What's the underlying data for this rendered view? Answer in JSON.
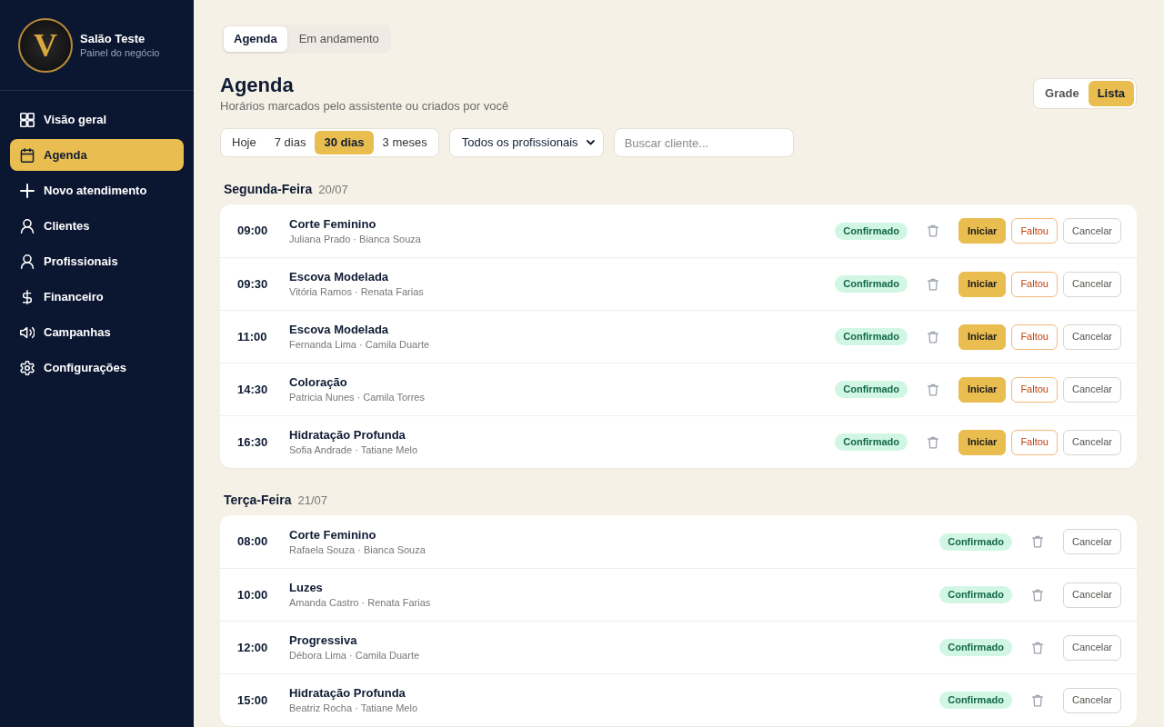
{
  "sidebar": {
    "brand": {
      "logo_letter": "V",
      "name": "Salão Teste",
      "subtitle": "Painel do negócio"
    },
    "items": [
      {
        "label": "Visão geral",
        "selected": false
      },
      {
        "label": "Agenda",
        "selected": true
      },
      {
        "label": "Novo atendimento",
        "selected": false
      },
      {
        "label": "Clientes",
        "selected": false
      },
      {
        "label": "Profissionais",
        "selected": false
      },
      {
        "label": "Financeiro",
        "selected": false
      },
      {
        "label": "Campanhas",
        "selected": false
      },
      {
        "label": "Configurações",
        "selected": false
      }
    ]
  },
  "tabs": [
    {
      "label": "Agenda",
      "selected": true
    },
    {
      "label": "Em andamento",
      "selected": false
    }
  ],
  "header": {
    "title": "Agenda",
    "subtitle": "Horários marcados pelo assistente ou criados por você"
  },
  "view_toggle": [
    {
      "label": "Grade",
      "selected": false
    },
    {
      "label": "Lista",
      "selected": true
    }
  ],
  "filters": {
    "periods": [
      {
        "label": "Hoje",
        "selected": false
      },
      {
        "label": "7 dias",
        "selected": false
      },
      {
        "label": "30 dias",
        "selected": true
      },
      {
        "label": "3 meses",
        "selected": false
      }
    ],
    "professional": {
      "value": "Todos os profissionais"
    },
    "search": {
      "placeholder": "Buscar cliente..."
    }
  },
  "days": [
    {
      "weekday": "Segunda-Feira",
      "date": "20/07",
      "appointments": [
        {
          "time": "09:00",
          "service": "Corte Feminino",
          "people": "Juliana Prado · Bianca Souza",
          "status": "Confirmado",
          "actions": [
            {
              "label": "Iniciar",
              "kind": "primary"
            },
            {
              "label": "Faltou",
              "kind": "warning"
            },
            {
              "label": "Cancelar",
              "kind": "neutral"
            }
          ]
        },
        {
          "time": "09:30",
          "service": "Escova Modelada",
          "people": "Vitória Ramos · Renata Farias",
          "status": "Confirmado",
          "actions": [
            {
              "label": "Iniciar",
              "kind": "primary"
            },
            {
              "label": "Faltou",
              "kind": "warning"
            },
            {
              "label": "Cancelar",
              "kind": "neutral"
            }
          ]
        },
        {
          "time": "11:00",
          "service": "Escova Modelada",
          "people": "Fernanda Lima · Camila Duarte",
          "status": "Confirmado",
          "actions": [
            {
              "label": "Iniciar",
              "kind": "primary"
            },
            {
              "label": "Faltou",
              "kind": "warning"
            },
            {
              "label": "Cancelar",
              "kind": "neutral"
            }
          ]
        },
        {
          "time": "14:30",
          "service": "Coloração",
          "people": "Patricia Nunes · Camila Torres",
          "status": "Confirmado",
          "actions": [
            {
              "label": "Iniciar",
              "kind": "primary"
            },
            {
              "label": "Faltou",
              "kind": "warning"
            },
            {
              "label": "Cancelar",
              "kind": "neutral"
            }
          ]
        },
        {
          "time": "16:30",
          "service": "Hidratação Profunda",
          "people": "Sofia Andrade · Tatiane Melo",
          "status": "Confirmado",
          "actions": [
            {
              "label": "Iniciar",
              "kind": "primary"
            },
            {
              "label": "Faltou",
              "kind": "warning"
            },
            {
              "label": "Cancelar",
              "kind": "neutral"
            }
          ]
        }
      ]
    },
    {
      "weekday": "Terça-Feira",
      "date": "21/07",
      "appointments": [
        {
          "time": "08:00",
          "service": "Corte Feminino",
          "people": "Rafaela Souza · Bianca Souza",
          "status": "Confirmado",
          "actions": [
            {
              "label": "Cancelar",
              "kind": "neutral"
            }
          ]
        },
        {
          "time": "10:00",
          "service": "Luzes",
          "people": "Amanda Castro · Renata Farias",
          "status": "Confirmado",
          "actions": [
            {
              "label": "Cancelar",
              "kind": "neutral"
            }
          ]
        },
        {
          "time": "12:00",
          "service": "Progressiva",
          "people": "Débora Lima · Camila Duarte",
          "status": "Confirmado",
          "actions": [
            {
              "label": "Cancelar",
              "kind": "neutral"
            }
          ]
        },
        {
          "time": "15:00",
          "service": "Hidratação Profunda",
          "people": "Beatriz Rocha · Tatiane Melo",
          "status": "Confirmado",
          "actions": [
            {
              "label": "Cancelar",
              "kind": "neutral"
            }
          ]
        }
      ]
    }
  ]
}
